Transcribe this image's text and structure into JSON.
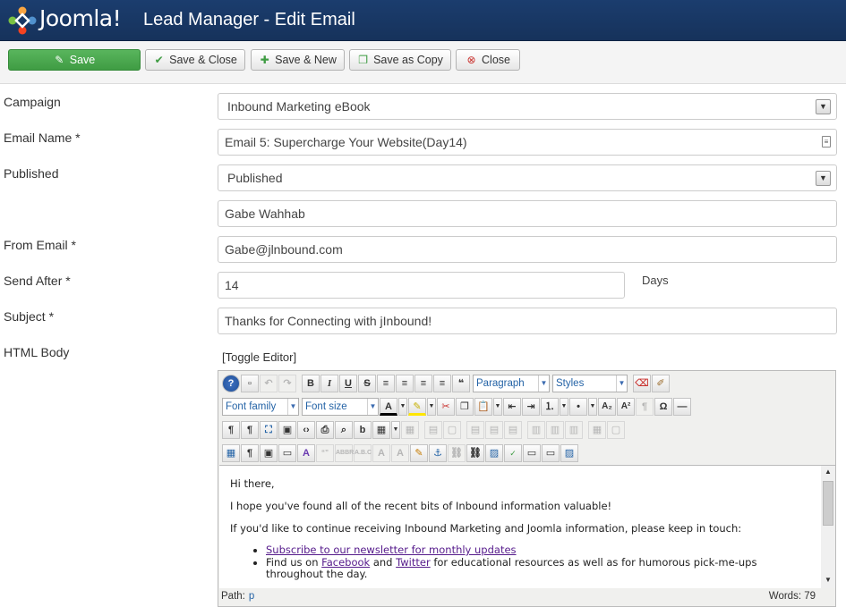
{
  "header": {
    "logo_text": "Joomla!",
    "title": "Lead Manager - Edit Email"
  },
  "toolbar": {
    "save": "Save",
    "save_close": "Save & Close",
    "save_new": "Save & New",
    "save_copy": "Save as Copy",
    "close": "Close"
  },
  "form": {
    "campaign_label": "Campaign",
    "campaign_value": "Inbound Marketing eBook",
    "email_name_label": "Email Name *",
    "email_name_value": "Email 5: Supercharge Your Website(Day14)",
    "published_label": "Published",
    "published_value": "Published",
    "from_name_value": "Gabe Wahhab",
    "from_email_label": "From Email *",
    "from_email_value": "Gabe@jlnbound.com",
    "send_after_label": "Send After *",
    "send_after_value": "14",
    "send_after_unit": "Days",
    "subject_label": "Subject *",
    "subject_value": "Thanks for Connecting with jInbound!",
    "html_body_label": "HTML Body"
  },
  "editor": {
    "toggle_label": "[Toggle Editor]",
    "format_select": "Paragraph",
    "styles_select": "Styles",
    "font_family_select": "Font family",
    "font_size_select": "Font size",
    "body": {
      "greeting": "Hi there,",
      "line1": "I hope you've found all of the recent bits of Inbound information valuable!",
      "line2": "If you'd like to continue receiving Inbound Marketing and Joomla information, please keep in touch:",
      "bullet1_link": "Subscribe to our newsletter for monthly updates",
      "bullet2_pre": "Find us on ",
      "bullet2_link1": "Facebook",
      "bullet2_mid": " and ",
      "bullet2_link2": "Twitter",
      "bullet2_post": " for educational resources as well as for humorous pick-me-ups throughout the day."
    },
    "status": {
      "path_label": "Path:",
      "path_value": "p",
      "words": "Words: 79"
    }
  },
  "colors": {
    "header_bg": "#1b3d6e",
    "save_green": "#4caf50",
    "link": "#551a8b"
  }
}
